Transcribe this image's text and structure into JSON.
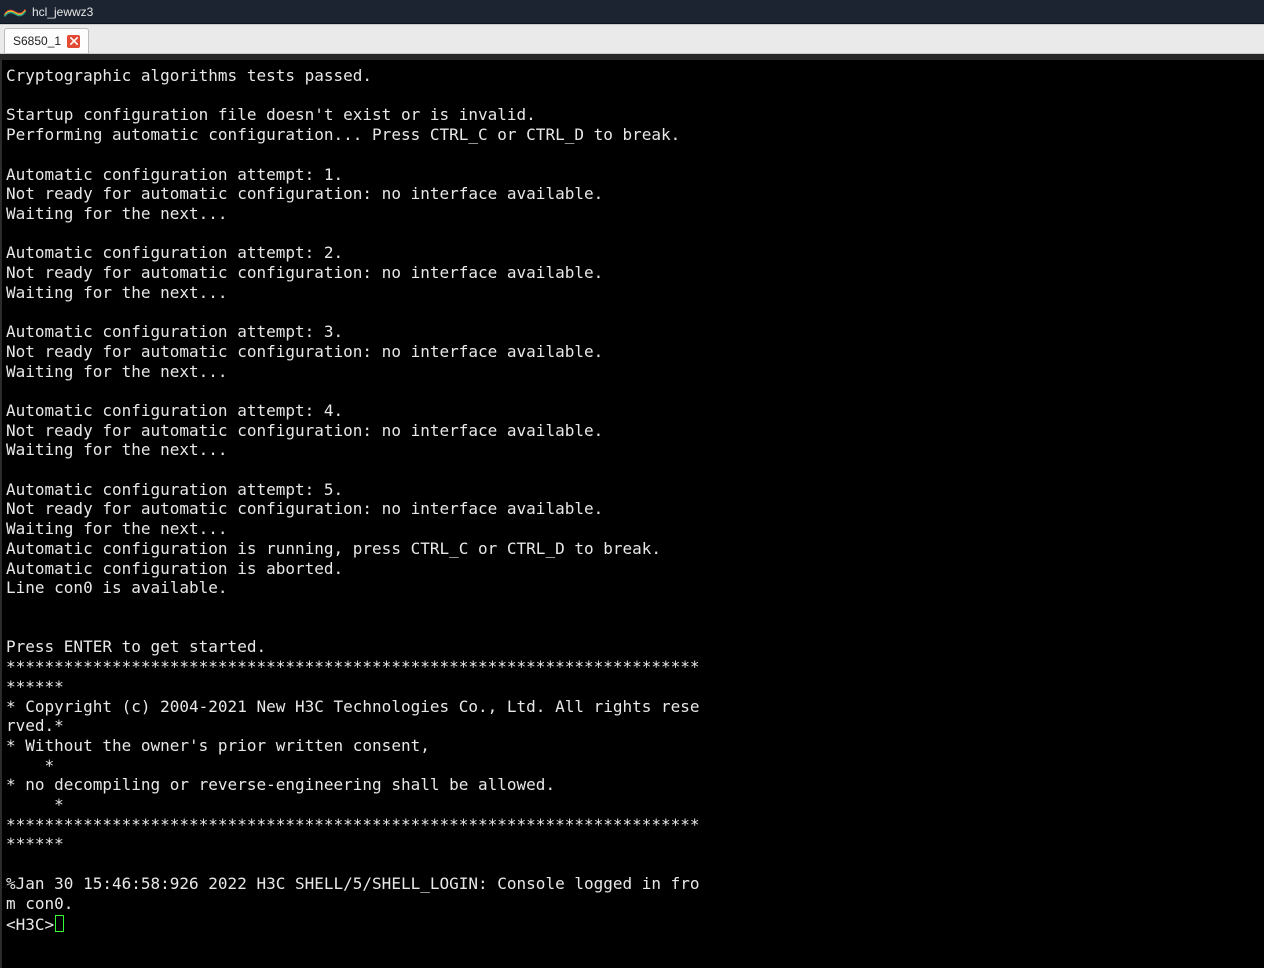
{
  "titlebar": {
    "title": "hcl_jewwz3"
  },
  "tabs": [
    {
      "label": "S6850_1"
    }
  ],
  "terminal": {
    "prompt": "<H3C>",
    "lines": [
      "Cryptographic algorithms tests passed.",
      "",
      "Startup configuration file doesn't exist or is invalid.",
      "Performing automatic configuration... Press CTRL_C or CTRL_D to break.",
      "",
      "Automatic configuration attempt: 1.",
      "Not ready for automatic configuration: no interface available.",
      "Waiting for the next...",
      "",
      "Automatic configuration attempt: 2.",
      "Not ready for automatic configuration: no interface available.",
      "Waiting for the next...",
      "",
      "Automatic configuration attempt: 3.",
      "Not ready for automatic configuration: no interface available.",
      "Waiting for the next...",
      "",
      "Automatic configuration attempt: 4.",
      "Not ready for automatic configuration: no interface available.",
      "Waiting for the next...",
      "",
      "Automatic configuration attempt: 5.",
      "Not ready for automatic configuration: no interface available.",
      "Waiting for the next...",
      "Automatic configuration is running, press CTRL_C or CTRL_D to break.",
      "Automatic configuration is aborted.",
      "Line con0 is available.",
      "",
      "",
      "Press ENTER to get started.",
      "******************************************************************************",
      "* Copyright (c) 2004-2021 New H3C Technologies Co., Ltd. All rights reserved.*",
      "* Without the owner's prior written consent,                                *",
      "* no decompiling or reverse-engineering shall be allowed.                    *",
      "******************************************************************************",
      "",
      "%Jan 30 15:46:58:926 2022 H3C SHELL/5/SHELL_LOGIN: Console logged in from con0."
    ]
  }
}
